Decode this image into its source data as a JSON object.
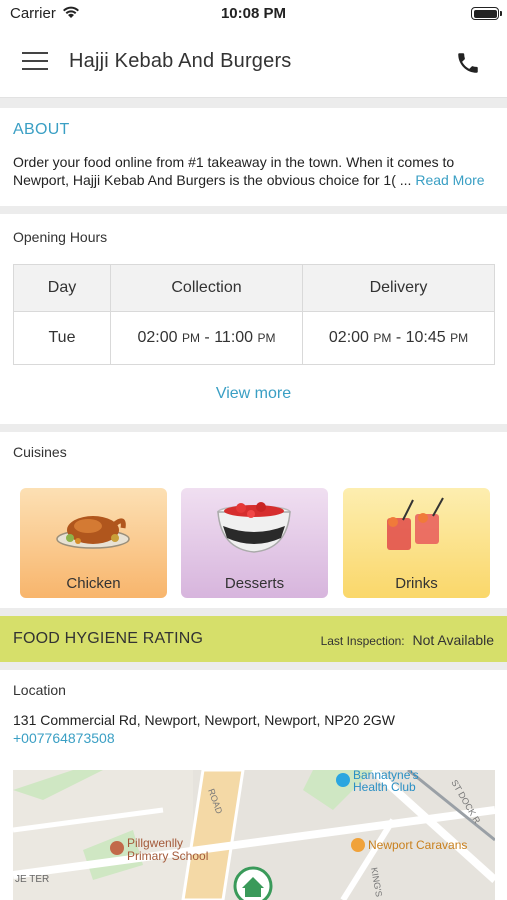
{
  "status_bar": {
    "carrier": "Carrier",
    "time": "10:08 PM"
  },
  "app_bar": {
    "title": "Hajji Kebab And Burgers"
  },
  "about": {
    "heading": "ABOUT",
    "text_line1": "Order your food online from #1 takeaway in the town. When it comes to",
    "text_line2": "Newport, Hajji Kebab And Burgers is the obvious choice for 1( ...",
    "read_more": "Read More"
  },
  "opening_hours": {
    "label": "Opening Hours",
    "columns": [
      "Day",
      "Collection",
      "Delivery"
    ],
    "row": {
      "day": "Tue",
      "collection_start": "02:00",
      "collection_start_ampm": "PM",
      "collection_end": "11:00",
      "collection_end_ampm": "PM",
      "delivery_start": "02:00",
      "delivery_start_ampm": "PM",
      "delivery_end": "10:45",
      "delivery_end_ampm": "PM"
    },
    "view_more": "View more"
  },
  "cuisines": {
    "label": "Cuisines",
    "items": [
      {
        "label": "Chicken",
        "icon": "roast-chicken-icon"
      },
      {
        "label": "Desserts",
        "icon": "dessert-bowl-icon"
      },
      {
        "label": "Drinks",
        "icon": "cocktail-glasses-icon"
      }
    ]
  },
  "hygiene": {
    "title": "FOOD HYGIENE RATING",
    "last_inspection_label": "Last Inspection:",
    "last_inspection_value": "Not Available",
    "color": "#d6df6a"
  },
  "location": {
    "label": "Location",
    "address": "131 Commercial Rd, Newport, Newport, Newport, NP20 2GW",
    "phone": "+007764873508",
    "map_labels": {
      "gym": "Bannatyne's",
      "gym2": "Health Club",
      "school": "Pillgwenlly",
      "school2": "Primary School",
      "caravans": "Newport Caravans",
      "road1": "ROAD",
      "road2": "ST DOCK R",
      "road3": "JE TER",
      "road4": "KING'S"
    }
  },
  "colors": {
    "accent": "#3a9fc4"
  }
}
